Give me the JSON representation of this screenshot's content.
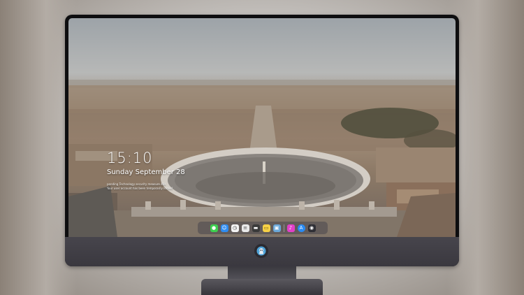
{
  "lockscreen": {
    "time": "15:10",
    "date": "Sunday September 28",
    "notice_line1": "pending Technology security measure 40s",
    "notice_line2": "Your user account has been temporarily locked"
  },
  "dock": {
    "apps": [
      {
        "name": "messages",
        "icon": "messages-icon",
        "color": "#3ecf4f",
        "glyph": "●"
      },
      {
        "name": "finder",
        "icon": "finder-icon",
        "color": "#2f8cf0",
        "glyph": "☺"
      },
      {
        "name": "clock",
        "icon": "clock-icon",
        "color": "#f4f4f4",
        "glyph": "◷"
      },
      {
        "name": "notes",
        "icon": "notes-icon",
        "color": "#e9e9e9",
        "glyph": "≡"
      },
      {
        "name": "claquette",
        "icon": "clapper-icon",
        "color": "#3a3a3a",
        "glyph": "▬"
      },
      {
        "name": "stickies",
        "icon": "stickies-icon",
        "color": "#f6d046",
        "glyph": "▭"
      },
      {
        "name": "preview",
        "icon": "preview-icon",
        "color": "#6aa7d8",
        "glyph": "▣"
      },
      {
        "name": "divider",
        "icon": "divider",
        "color": "transparent",
        "glyph": "|"
      },
      {
        "name": "itunes",
        "icon": "music-icon",
        "color": "#e240c8",
        "glyph": "♪"
      },
      {
        "name": "appstore",
        "icon": "appstore-icon",
        "color": "#2a8bf2",
        "glyph": "A"
      },
      {
        "name": "camera",
        "icon": "camera-icon",
        "color": "#2f2f35",
        "glyph": "◉"
      }
    ]
  },
  "colors": {
    "bezel": "#0e0e10",
    "chin": "#3f3d44",
    "stand": "#4a484e"
  }
}
